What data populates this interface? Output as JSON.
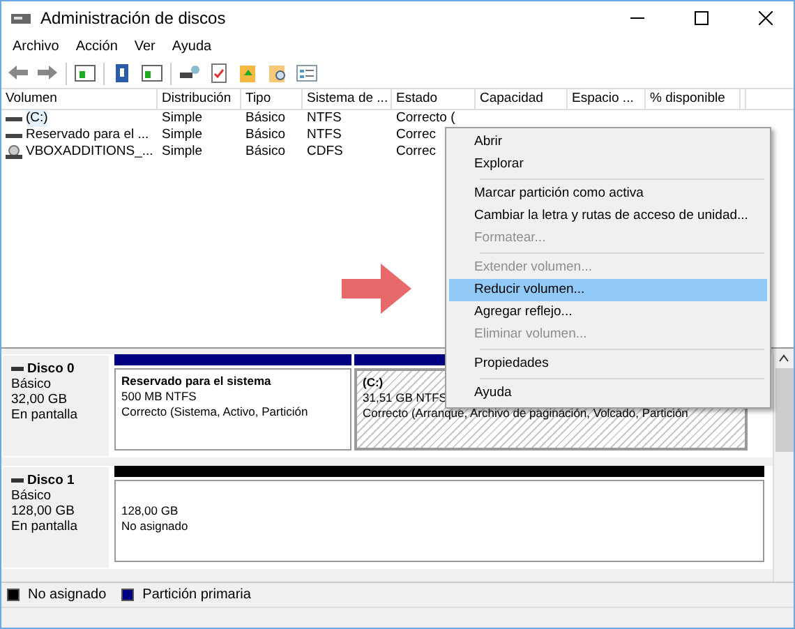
{
  "window": {
    "title": "Administración de discos"
  },
  "menu": [
    "Archivo",
    "Acción",
    "Ver",
    "Ayuda"
  ],
  "table": {
    "columns": [
      "Volumen",
      "Distribución",
      "Tipo",
      "Sistema de ...",
      "Estado",
      "Capacidad",
      "Espacio ...",
      "% disponible"
    ],
    "rows": [
      {
        "kind": "drive",
        "cells": [
          "(C:)",
          "Simple",
          "Básico",
          "NTFS",
          "Correcto ("
        ],
        "selected": true
      },
      {
        "kind": "drive",
        "cells": [
          "Reservado para el ...",
          "Simple",
          "Básico",
          "NTFS",
          "Correc"
        ],
        "selected": false
      },
      {
        "kind": "cd",
        "cells": [
          "VBOXADDITIONS_...",
          "Simple",
          "Básico",
          "CDFS",
          "Correc"
        ],
        "selected": false
      }
    ]
  },
  "context_menu": [
    {
      "kind": "item",
      "label": "Abrir",
      "disabled": false,
      "selected": false
    },
    {
      "kind": "item",
      "label": "Explorar",
      "disabled": false,
      "selected": false
    },
    {
      "kind": "separator"
    },
    {
      "kind": "item",
      "label": "Marcar partición como activa",
      "disabled": false,
      "selected": false
    },
    {
      "kind": "item",
      "label": "Cambiar la letra y rutas de acceso de unidad...",
      "disabled": false,
      "selected": false
    },
    {
      "kind": "item",
      "label": "Formatear...",
      "disabled": true,
      "selected": false
    },
    {
      "kind": "separator"
    },
    {
      "kind": "item",
      "label": "Extender volumen...",
      "disabled": true,
      "selected": false
    },
    {
      "kind": "item",
      "label": "Reducir volumen...",
      "disabled": false,
      "selected": true
    },
    {
      "kind": "item",
      "label": "Agregar reflejo...",
      "disabled": false,
      "selected": false
    },
    {
      "kind": "item",
      "label": "Eliminar volumen...",
      "disabled": true,
      "selected": false
    },
    {
      "kind": "separator"
    },
    {
      "kind": "item",
      "label": "Propiedades",
      "disabled": false,
      "selected": false
    },
    {
      "kind": "separator"
    },
    {
      "kind": "item",
      "label": "Ayuda",
      "disabled": false,
      "selected": false
    }
  ],
  "disks": [
    {
      "name": "Disco 0",
      "lines": [
        "Básico",
        "32,00 GB",
        "En pantalla"
      ],
      "partitions": [
        {
          "kind": "primary",
          "title": "Reservado para el sistema",
          "lines": [
            "500 MB NTFS",
            "Correcto (Sistema, Activo, Partición"
          ],
          "selected": false,
          "color": "#000080"
        },
        {
          "kind": "primary",
          "title": "(C:)",
          "lines": [
            "31,51 GB NTFS",
            "Correcto (Arranque, Archivo de paginación, Volcado, Partición"
          ],
          "selected": true,
          "color": "#000080"
        }
      ]
    },
    {
      "name": "Disco 1",
      "lines": [
        "Básico",
        "128,00 GB",
        "En pantalla"
      ],
      "partitions": [
        {
          "kind": "unallocated",
          "lines": [
            "128,00 GB",
            "No asignado"
          ],
          "selected": false,
          "color": "#000000"
        }
      ]
    }
  ],
  "legend": [
    {
      "label": "No asignado",
      "color": "#000000"
    },
    {
      "label": "Partición primaria",
      "color": "#000080"
    }
  ]
}
